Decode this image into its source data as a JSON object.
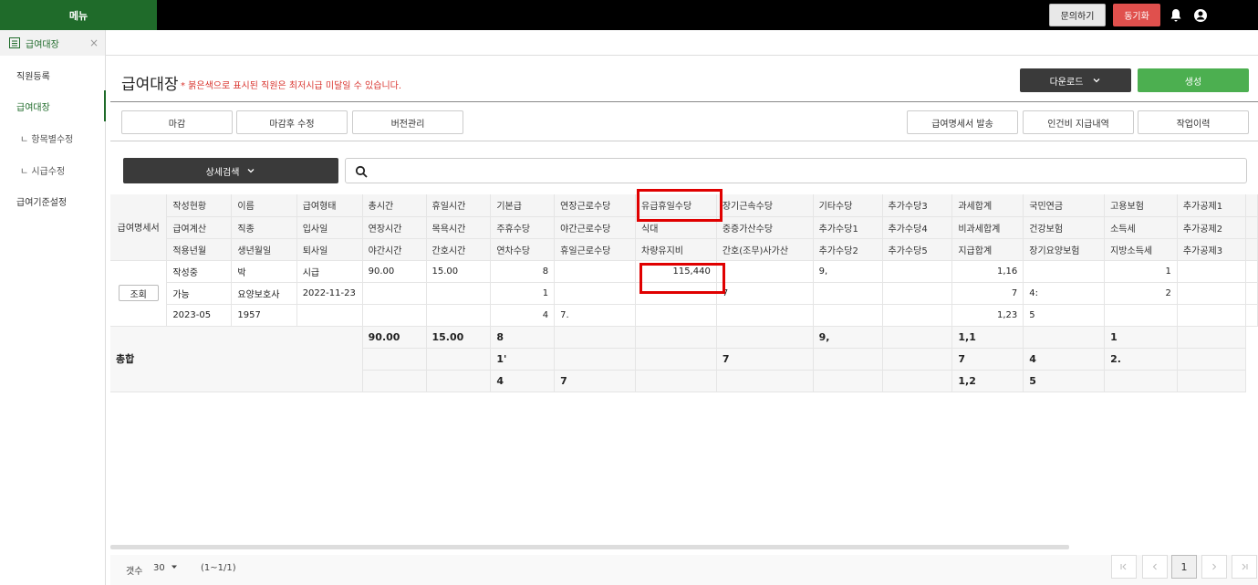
{
  "topbar": {
    "menu": "메뉴",
    "inquiry": "문의하기",
    "sync": "동기화"
  },
  "tab": {
    "label": "급여대장",
    "close": "×"
  },
  "sidebar": [
    {
      "label": "직원등록"
    },
    {
      "label": "급여대장"
    },
    {
      "label": "ㄴ 항목별수정"
    },
    {
      "label": "ㄴ 시급수정"
    },
    {
      "label": "급여기준설정"
    }
  ],
  "page": {
    "title": "급여대장",
    "warning": "* 붉은색으로 표시된 직원은 최저시급 미달일 수 있습니다.",
    "download": "다운로드",
    "create": "생성",
    "buttons": [
      "마감",
      "마감후 수정",
      "버전관리",
      "급여명세서 발송",
      "인건비 지급내역",
      "작업이력"
    ],
    "detail_search": "상세검색"
  },
  "table": {
    "slip_header": "급여명세서",
    "header_rows": [
      [
        "작성현황",
        "이름",
        "급여형태",
        "총시간",
        "휴일시간",
        "기본급",
        "연장근로수당",
        "유급휴일수당",
        "장기근속수당",
        "기타수당",
        "추가수당3",
        "과세합계",
        "국민연금",
        "고용보험",
        "추가공제1"
      ],
      [
        "급여계산",
        "직종",
        "입사일",
        "연장시간",
        "목욕시간",
        "주휴수당",
        "야간근로수당",
        "식대",
        "중증가산수당",
        "추가수당1",
        "추가수당4",
        "비과세합계",
        "건강보험",
        "소득세",
        "추가공제2"
      ],
      [
        "적용년월",
        "생년월일",
        "퇴사일",
        "야간시간",
        "간호시간",
        "연차수당",
        "휴일근로수당",
        "차량유지비",
        "간호(조무)사가산",
        "추가수당2",
        "추가수당5",
        "지급합계",
        "장기요양보험",
        "지방소득세",
        "추가공제3"
      ]
    ],
    "view_button": "조회",
    "data_rows": [
      [
        "작성중",
        "박",
        "시급",
        "90.00",
        "15.00",
        "8",
        "",
        "115,440",
        "",
        "9,",
        "",
        "1,16",
        "",
        "1",
        ""
      ],
      [
        "가능",
        "요양보호사",
        "2022-11-23",
        "",
        "",
        "1",
        "",
        "",
        "7",
        "",
        "",
        "7",
        "4:",
        "2",
        ""
      ],
      [
        "2023-05",
        "1957",
        "",
        "",
        "",
        "4",
        "7.",
        "",
        "",
        "",
        "",
        "1,23",
        "5",
        "",
        ""
      ]
    ],
    "total_label": "총합",
    "total_rows": [
      [
        "90.00",
        "15.00",
        "8",
        "",
        "",
        "",
        "9,",
        "",
        "1,1",
        "",
        "1",
        ""
      ],
      [
        "",
        "",
        "1'",
        "",
        "",
        "7",
        "",
        "",
        "7",
        "4",
        "2.",
        ""
      ],
      [
        "",
        "",
        "4",
        "7",
        "",
        "",
        "",
        "",
        "1,2",
        "5",
        "",
        ""
      ]
    ]
  },
  "footer": {
    "count_label": "갯수",
    "count_value": "30",
    "range": "(1~1/1)",
    "current_page": "1"
  }
}
